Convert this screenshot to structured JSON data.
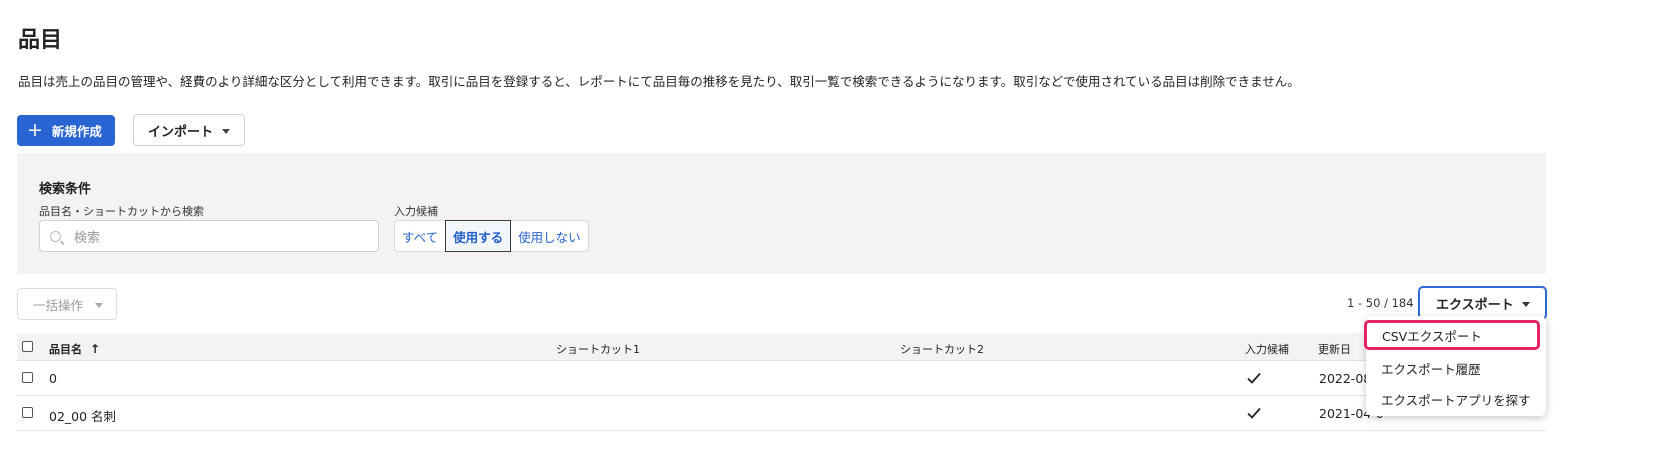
{
  "header": {
    "title": "品目",
    "description": "品目は売上の品目の管理や、経費のより詳細な区分として利用できます。取引に品目を登録すると、レポートにて品目毎の推移を見たり、取引一覧で検索できるようになります。取引などで使用されている品目は削除できません。"
  },
  "toolbar": {
    "new_label": "新規作成",
    "import_label": "インポート"
  },
  "search": {
    "heading": "検索条件",
    "name_label": "品目名・ショートカットから検索",
    "placeholder": "検索",
    "suggest_label": "入力候補",
    "options": [
      "すべて",
      "使用する",
      "使用しない"
    ],
    "selected": "使用する"
  },
  "list_controls": {
    "bulk_label": "一括操作",
    "pagination": "1 - 50 / 184",
    "export_label": "エクスポート"
  },
  "export_menu": {
    "items": [
      "CSVエクスポート",
      "エクスポート履歴",
      "エクスポートアプリを探す"
    ],
    "highlighted": "CSVエクスポート"
  },
  "table": {
    "columns": {
      "name": "品目名",
      "shortcut1": "ショートカット1",
      "shortcut2": "ショートカット2",
      "suggest": "入力候補",
      "updated": "更新日"
    },
    "rows": [
      {
        "name": "0",
        "updated": "2022-08-"
      },
      {
        "name": "02_00 名刺",
        "updated": "2021-04-0"
      }
    ]
  },
  "icons": [
    "plus-icon",
    "chevron-down-icon",
    "search-icon",
    "sort-up-icon",
    "checkmark-icon"
  ],
  "colors": {
    "primary": "#2864d2",
    "highlight": "#e8245f",
    "panel_bg": "#f4f2f2"
  }
}
